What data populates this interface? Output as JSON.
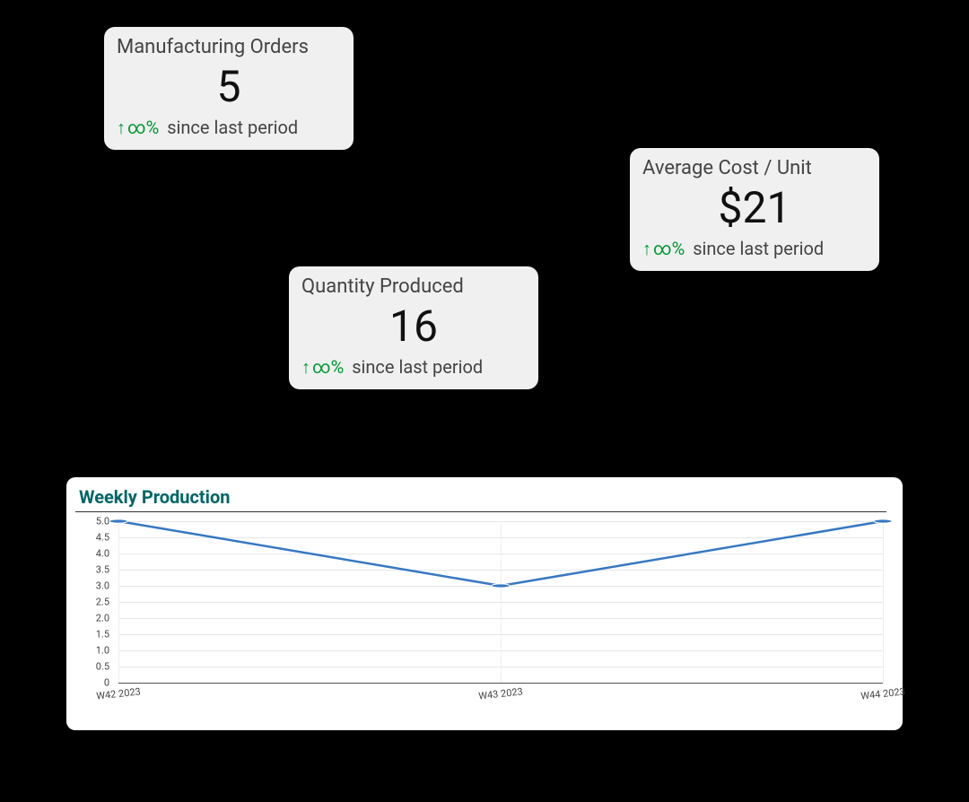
{
  "kpis": {
    "orders": {
      "title": "Manufacturing Orders",
      "value": "5",
      "delta_pct": "∞%",
      "delta_since": "since last period"
    },
    "quantity": {
      "title": "Quantity Produced",
      "value": "16",
      "delta_pct": "∞%",
      "delta_since": "since last period"
    },
    "avg_cost": {
      "title": "Average Cost / Unit",
      "value": "$21",
      "delta_pct": "∞%",
      "delta_since": "since last period"
    }
  },
  "chart": {
    "title": "Weekly Production",
    "y_ticks": [
      "0",
      "0.5",
      "1.0",
      "1.5",
      "2.0",
      "2.5",
      "3.0",
      "3.5",
      "4.0",
      "4.5",
      "5.0"
    ],
    "x_labels": [
      "W42 2023",
      "W43 2023",
      "W44 2023"
    ]
  },
  "chart_data": {
    "type": "line",
    "title": "Weekly Production",
    "xlabel": "",
    "ylabel": "",
    "ylim": [
      0,
      5
    ],
    "categories": [
      "W42 2023",
      "W43 2023",
      "W44 2023"
    ],
    "values": [
      5,
      3,
      5
    ]
  }
}
